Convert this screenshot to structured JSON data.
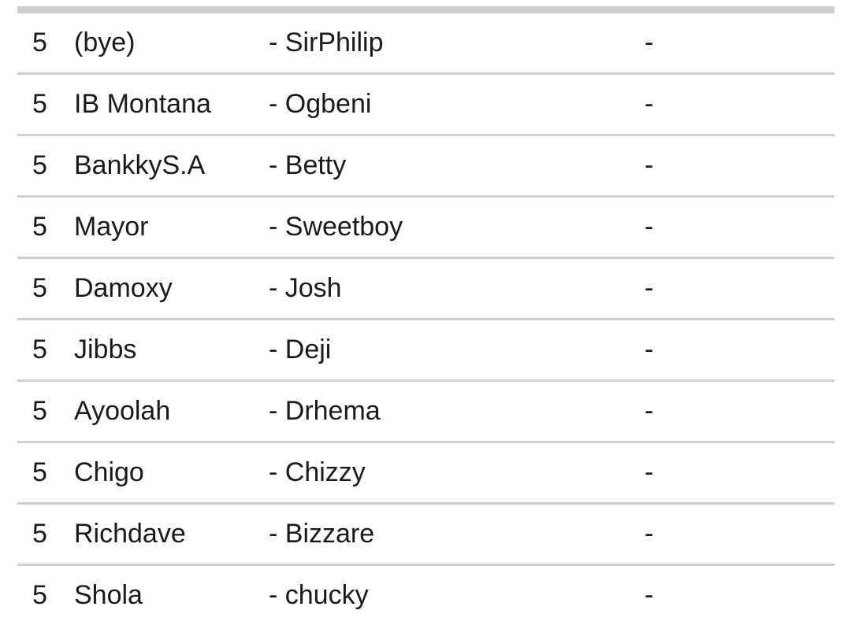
{
  "fixtures": {
    "rows": [
      {
        "round": "5",
        "home": "(bye)",
        "away": "- SirPhilip",
        "score": "-"
      },
      {
        "round": "5",
        "home": "IB Montana",
        "away": "- Ogbeni",
        "score": "-"
      },
      {
        "round": "5",
        "home": "BankkyS.A",
        "away": "- Betty",
        "score": "-"
      },
      {
        "round": "5",
        "home": "Mayor",
        "away": "- Sweetboy",
        "score": "-"
      },
      {
        "round": "5",
        "home": "Damoxy",
        "away": "- Josh",
        "score": "-"
      },
      {
        "round": "5",
        "home": "Jibbs",
        "away": "- Deji",
        "score": "-"
      },
      {
        "round": "5",
        "home": "Ayoolah",
        "away": "- Drhema",
        "score": "-"
      },
      {
        "round": "5",
        "home": "Chigo",
        "away": "- Chizzy",
        "score": "-"
      },
      {
        "round": "5",
        "home": "Richdave",
        "away": "- Bizzare",
        "score": "-"
      },
      {
        "round": "5",
        "home": "Shola",
        "away": "- chucky",
        "score": "-"
      }
    ]
  }
}
